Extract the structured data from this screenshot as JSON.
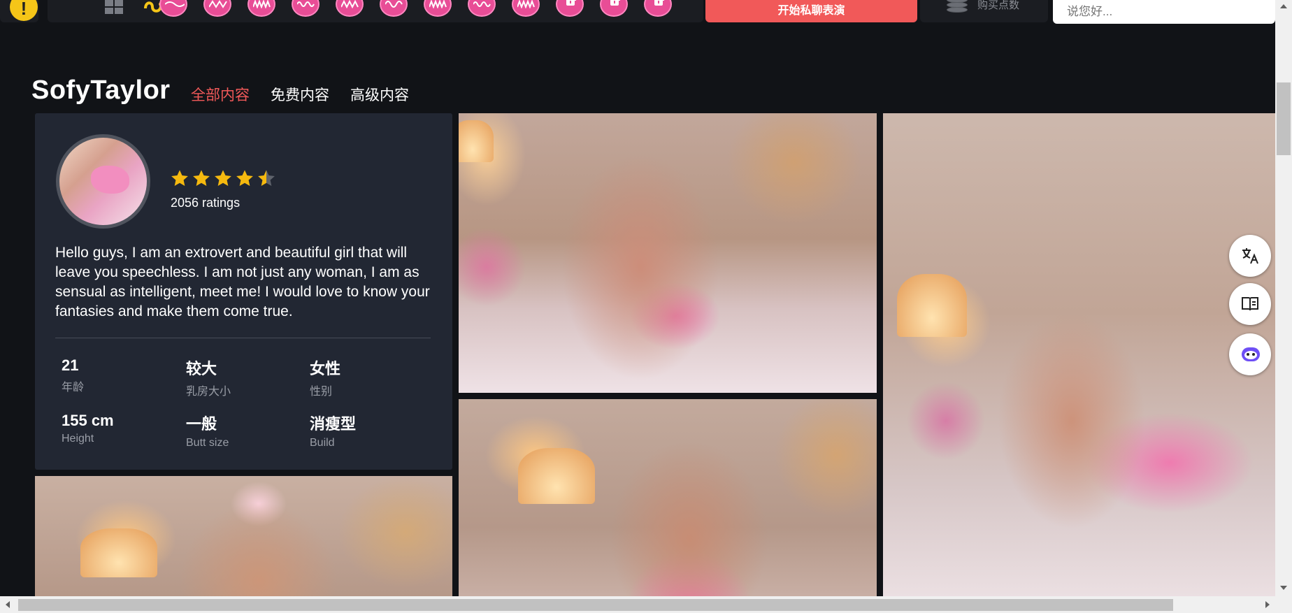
{
  "toolbar": {
    "private_show_label": "开始私聊表演",
    "tokens_label": "购买点数",
    "chat_placeholder": "说您好..."
  },
  "header": {
    "model_name": "SofyTaylor",
    "tabs": [
      {
        "label": "全部内容",
        "active": true
      },
      {
        "label": "免费内容",
        "active": false
      },
      {
        "label": "高级内容",
        "active": false
      }
    ]
  },
  "profile": {
    "rating": 4.5,
    "ratings_text": "2056 ratings",
    "bio": "Hello guys, I am an extrovert and beautiful girl that will leave you speechless. I am not just any woman, I am as sensual as intelligent, meet me! I would love to know your fantasies and make them come true.",
    "stats": [
      {
        "value": "21",
        "label": "年龄"
      },
      {
        "value": "较大",
        "label": "乳房大小"
      },
      {
        "value": "女性",
        "label": "性别"
      },
      {
        "value": "155 cm",
        "label": "Height"
      },
      {
        "value": "一般",
        "label": "Butt size"
      },
      {
        "value": "消瘦型",
        "label": "Build"
      }
    ]
  },
  "colors": {
    "accent_red": "#f15959",
    "star_gold": "#f5b90f",
    "card_bg": "#222733",
    "page_bg": "#111317"
  },
  "icons": {
    "badge": "info-badge-icon",
    "grid": "grid-icon",
    "snake": "snake-icon",
    "translate": "translate-icon",
    "reader": "reader-icon",
    "assistant": "assistant-bot-icon"
  }
}
